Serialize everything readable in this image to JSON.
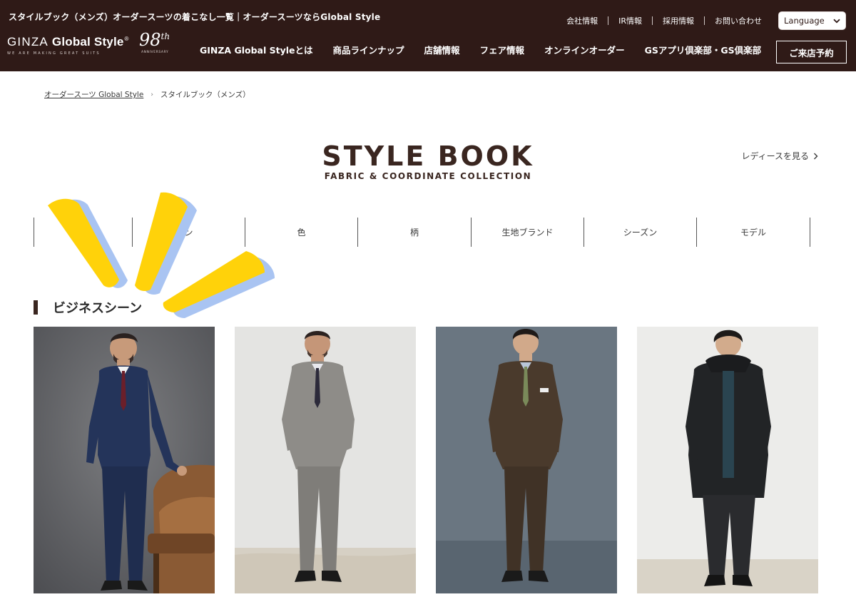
{
  "header": {
    "page_heading": "スタイルブック（メンズ）オーダースーツの着こなし一覧｜オーダースーツならGlobal Style",
    "util_links": [
      {
        "label": "会社情報"
      },
      {
        "label": "IR情報"
      },
      {
        "label": "採用情報"
      },
      {
        "label": "お問い合わせ"
      }
    ],
    "language": "Language",
    "logo": {
      "ginza": "GINZA",
      "brand": "Global Style",
      "reg": "®",
      "tagline": "WE ARE MAKING GREAT SUITS",
      "anniversary_num": "98",
      "anniversary_sup": "th",
      "anniversary_label": "ANNIVERSARY"
    },
    "nav": [
      {
        "label": "GINZA Global Styleとは"
      },
      {
        "label": "商品ラインナップ"
      },
      {
        "label": "店舗情報"
      },
      {
        "label": "フェア情報"
      },
      {
        "label": "オンラインオーダー"
      },
      {
        "label": "GSアプリ倶楽部・GS倶楽部"
      }
    ],
    "reserve_button": "ご来店予約"
  },
  "breadcrumb": {
    "home": "オーダースーツ Global Style",
    "current": "スタイルブック（メンズ）"
  },
  "title": {
    "main": "STYLE BOOK",
    "sub": "FABRIC & COORDINATE COLLECTION"
  },
  "ladies_link": "レディースを見る",
  "tabs": [
    {
      "label": ""
    },
    {
      "label": "ン"
    },
    {
      "label": "色"
    },
    {
      "label": "柄"
    },
    {
      "label": "生地ブランド"
    },
    {
      "label": "シーズン"
    },
    {
      "label": "モデル"
    }
  ],
  "section": {
    "title": "ビジネスシーン"
  },
  "colors": {
    "header_bg": "#2f1a17",
    "title_text": "#3a2620",
    "sparkle_yellow": "#ffd20a",
    "sparkle_shadow": "#a9c4f2"
  },
  "photos": [
    {
      "icon": "navy-three-piece-suit-photo"
    },
    {
      "icon": "grey-double-breasted-suit-photo"
    },
    {
      "icon": "brown-three-piece-suit-photo"
    },
    {
      "icon": "black-hooded-coat-photo"
    }
  ]
}
